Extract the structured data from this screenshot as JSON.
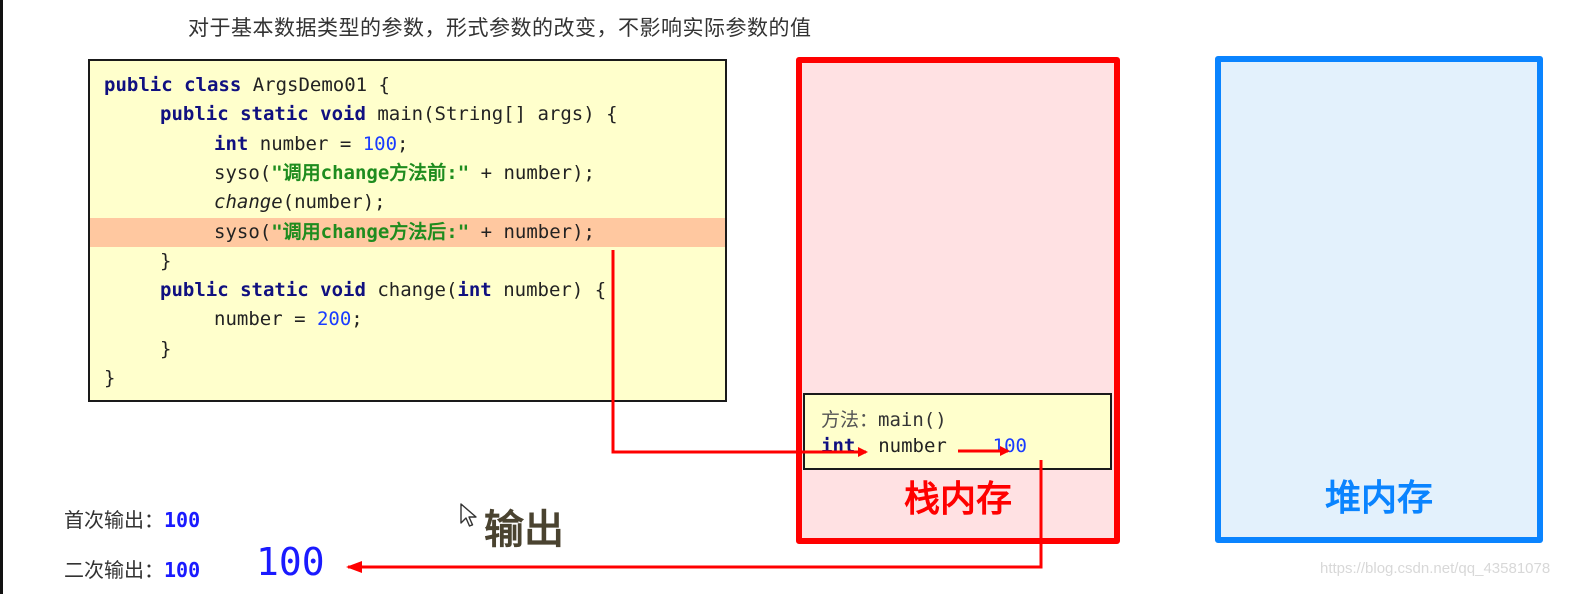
{
  "title": "对于基本数据类型的参数，形式参数的改变，不影响实际参数的值",
  "code": {
    "lines": [
      {
        "indent": 0,
        "tokens": [
          {
            "t": "public class ",
            "c": "kw"
          },
          {
            "t": "ArgsDemo01 {",
            "c": ""
          }
        ]
      },
      {
        "indent": 1,
        "tokens": [
          {
            "t": "public static void ",
            "c": "kw"
          },
          {
            "t": "main(String[] args) {",
            "c": ""
          }
        ]
      },
      {
        "indent": 2,
        "tokens": [
          {
            "t": "int ",
            "c": "kw"
          },
          {
            "t": "number = ",
            "c": ""
          },
          {
            "t": "100",
            "c": "num"
          },
          {
            "t": ";",
            "c": ""
          }
        ]
      },
      {
        "indent": 2,
        "tokens": [
          {
            "t": "syso(",
            "c": ""
          },
          {
            "t": "\"调用change方法前:\"",
            "c": "str"
          },
          {
            "t": " + number);",
            "c": ""
          }
        ]
      },
      {
        "indent": 2,
        "tokens": [
          {
            "t": "change",
            "c": "it"
          },
          {
            "t": "(number);",
            "c": ""
          }
        ]
      },
      {
        "indent": 2,
        "highlight": true,
        "tokens": [
          {
            "t": "syso(",
            "c": ""
          },
          {
            "t": "\"调用change方法后:\"",
            "c": "str"
          },
          {
            "t": " + number);",
            "c": ""
          }
        ]
      },
      {
        "indent": 1,
        "tokens": [
          {
            "t": "}",
            "c": ""
          }
        ]
      },
      {
        "indent": 1,
        "tokens": [
          {
            "t": "public static void ",
            "c": "kw"
          },
          {
            "t": "change(",
            "c": ""
          },
          {
            "t": "int ",
            "c": "kw"
          },
          {
            "t": "number) {",
            "c": ""
          }
        ]
      },
      {
        "indent": 2,
        "tokens": [
          {
            "t": "number = ",
            "c": ""
          },
          {
            "t": "200",
            "c": "num"
          },
          {
            "t": ";",
            "c": ""
          }
        ]
      },
      {
        "indent": 1,
        "tokens": [
          {
            "t": "}",
            "c": ""
          }
        ]
      },
      {
        "indent": 0,
        "tokens": [
          {
            "t": "}",
            "c": ""
          }
        ]
      }
    ]
  },
  "stack": {
    "label": "栈内存",
    "color": "#ff0000",
    "frame": {
      "method_label": "方法：",
      "method_name": "main()",
      "var_type": "int",
      "var_name": "number",
      "var_value": "100"
    }
  },
  "heap": {
    "label": "堆内存",
    "color": "#0a84ff"
  },
  "output": {
    "label": "输出",
    "first_label": "首次输出：",
    "first_value": "100",
    "second_label": "二次输出：",
    "second_value": "100",
    "second_value_big": "100"
  },
  "watermark": "https://blog.csdn.net/qq_43581078"
}
